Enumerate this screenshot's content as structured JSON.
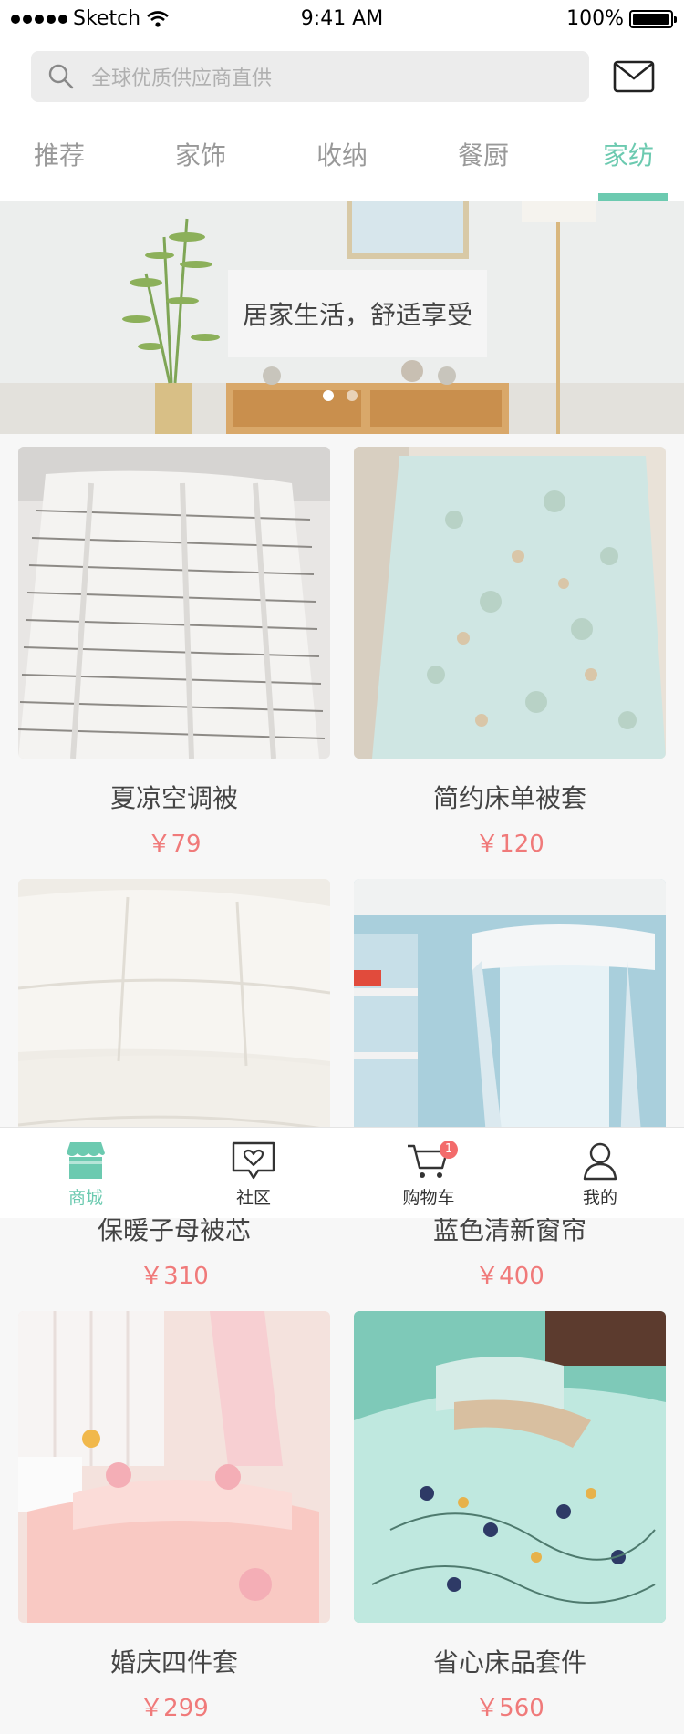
{
  "status_bar": {
    "carrier": "Sketch",
    "time": "9:41 AM",
    "battery": "100%"
  },
  "search": {
    "placeholder": "全球优质供应商直供"
  },
  "tabs": [
    {
      "label": "推荐",
      "active": false
    },
    {
      "label": "家饰",
      "active": false
    },
    {
      "label": "收纳",
      "active": false
    },
    {
      "label": "餐厨",
      "active": false
    },
    {
      "label": "家纺",
      "active": true
    }
  ],
  "banner": {
    "caption": "居家生活，舒适享受",
    "slides": 2,
    "current": 1
  },
  "products": [
    {
      "name": "夏凉空调被",
      "price": "￥79"
    },
    {
      "name": "简约床单被套",
      "price": "￥120"
    },
    {
      "name": "保暖子母被芯",
      "price": "￥310"
    },
    {
      "name": "蓝色清新窗帘",
      "price": "￥400"
    },
    {
      "name": "婚庆四件套",
      "price": "￥299"
    },
    {
      "name": "省心床品套件",
      "price": "￥560"
    }
  ],
  "tabbar": {
    "items": [
      {
        "label": "商城",
        "icon": "shop-icon",
        "active": true
      },
      {
        "label": "社区",
        "icon": "community-heart-icon",
        "active": false
      },
      {
        "label": "购物车",
        "icon": "cart-icon",
        "active": false,
        "badge": "1"
      },
      {
        "label": "我的",
        "icon": "profile-icon",
        "active": false
      }
    ]
  },
  "colors": {
    "accent": "#6ccab0",
    "price": "#f07a7a"
  }
}
